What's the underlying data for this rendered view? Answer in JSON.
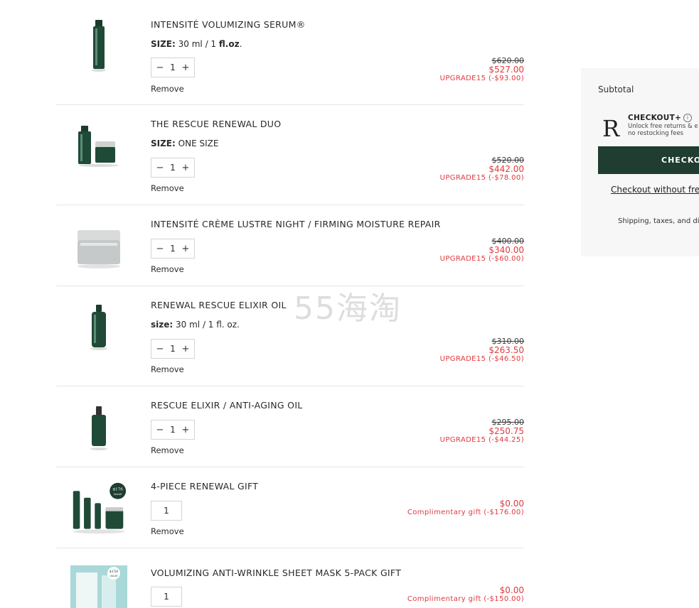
{
  "items": [
    {
      "title": "INTENSITÉ VOLUMIZING SERUM®",
      "size_label": "SIZE:",
      "size_value": "30 ml / 1 ",
      "size_bold": "fl.oz",
      "size_tail": ".",
      "qty": "1",
      "remove": "Remove",
      "old_price": "$620.00",
      "new_price": "$527.00",
      "discount": "UPGRADE15 (-$93.00)"
    },
    {
      "title": "THE RESCUE RENEWAL DUO",
      "size_label": "SIZE:",
      "size_value": "ONE SIZE",
      "size_bold": "",
      "size_tail": "",
      "qty": "1",
      "remove": "Remove",
      "old_price": "$520.00",
      "new_price": "$442.00",
      "discount": "UPGRADE15 (-$78.00)"
    },
    {
      "title": "INTENSITÉ CRÈME LUSTRE NIGHT / FIRMING MOISTURE REPAIR",
      "qty": "1",
      "remove": "Remove",
      "old_price": "$400.00",
      "new_price": "$340.00",
      "discount": "UPGRADE15 (-$60.00)"
    },
    {
      "title": "RENEWAL RESCUE ELIXIR OIL",
      "size_label": "size:",
      "size_value": "30 ml / 1 fl. oz.",
      "size_bold": "",
      "size_tail": "",
      "qty": "1",
      "remove": "Remove",
      "old_price": "$310.00",
      "new_price": "$263.50",
      "discount": "UPGRADE15 (-$46.50)"
    },
    {
      "title": "RESCUE ELIXIR / ANTI-AGING OIL",
      "qty": "1",
      "remove": "Remove",
      "old_price": "$295.00",
      "new_price": "$250.75",
      "discount": "UPGRADE15 (-$44.25)"
    },
    {
      "title": "4-PIECE RENEWAL GIFT",
      "qty": "1",
      "remove": "Remove",
      "new_price": "$0.00",
      "discount": "Complimentary gift (-$176.00)",
      "badge_value": "$176",
      "badge_text": "VALUE"
    },
    {
      "title": "VOLUMIZING ANTI-WRINKLE SHEET MASK 5-PACK GIFT",
      "qty": "1",
      "new_price": "$0.00",
      "discount": "Complimentary gift (-$150.00)",
      "badge_value": "$150",
      "badge_text": "VALUE"
    }
  ],
  "qty_controls": {
    "minus": "−",
    "plus": "+"
  },
  "summary": {
    "subtotal_label": "Subtotal",
    "checkout_plus_logo": "R",
    "checkout_plus_title": "CHECKOUT+",
    "checkout_plus_info": "i",
    "checkout_plus_line1": "Unlock free returns & e",
    "checkout_plus_line2": "no restocking fees",
    "checkout_button": "CHECKO",
    "checkout_without": "Checkout without fre",
    "shipping_note": "Shipping, taxes, and di"
  },
  "watermark": "55海淘",
  "colors": {
    "accent": "#1f3d30",
    "sale": "#e0393e",
    "summary_bg": "#f7f7f7"
  }
}
